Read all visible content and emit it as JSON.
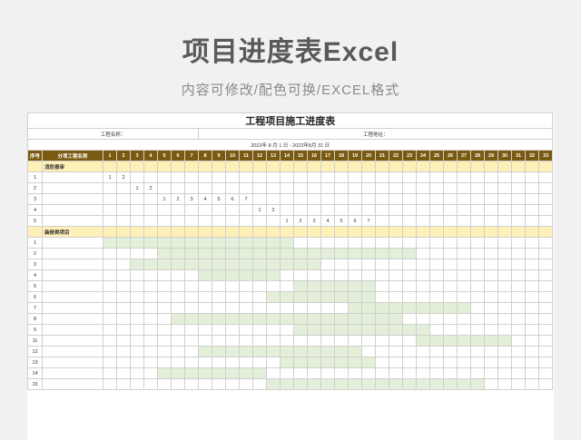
{
  "banner": {
    "title": "项目进度表Excel",
    "subtitle": "内容可修改/配色可换/EXCEL格式"
  },
  "sheet": {
    "title": "工程项目施工进度表",
    "project_name_label": "工程名称：",
    "project_address_label": "工程地址：",
    "date_range": "2022年 8 月 1 日 - 2022年8月 31 日",
    "col_index_header": "序号",
    "col_item_header": "分项工程名称",
    "days": [
      "1",
      "2",
      "3",
      "4",
      "5",
      "6",
      "7",
      "8",
      "9",
      "10",
      "11",
      "12",
      "13",
      "14",
      "15",
      "16",
      "17",
      "18",
      "19",
      "20",
      "21",
      "22",
      "23",
      "24",
      "25",
      "26",
      "27",
      "28",
      "29",
      "30",
      "31",
      "32",
      "33"
    ],
    "colors": {
      "header_bg": "#7a5a10",
      "category_bg": "#fff0b8",
      "bar_green": "#e3efd8"
    },
    "sections": [
      {
        "name": "消防报审",
        "rows": [
          {
            "no": "1",
            "cells": [
              {
                "day": 1,
                "text": "1"
              },
              {
                "day": 2,
                "text": "2"
              }
            ]
          },
          {
            "no": "2",
            "cells": [
              {
                "day": 3,
                "text": "1"
              },
              {
                "day": 4,
                "text": "2"
              }
            ]
          },
          {
            "no": "3",
            "cells": [
              {
                "day": 5,
                "text": "1"
              },
              {
                "day": 6,
                "text": "2"
              },
              {
                "day": 7,
                "text": "3"
              },
              {
                "day": 8,
                "text": "4"
              },
              {
                "day": 9,
                "text": "5"
              },
              {
                "day": 10,
                "text": "6"
              },
              {
                "day": 11,
                "text": "7"
              }
            ]
          },
          {
            "no": "4",
            "cells": [
              {
                "day": 12,
                "text": "1"
              },
              {
                "day": 13,
                "text": "2"
              }
            ]
          },
          {
            "no": "5",
            "cells": [
              {
                "day": 14,
                "text": "1"
              },
              {
                "day": 15,
                "text": "2"
              },
              {
                "day": 16,
                "text": "3"
              },
              {
                "day": 17,
                "text": "4"
              },
              {
                "day": 18,
                "text": "5"
              },
              {
                "day": 19,
                "text": "6"
              },
              {
                "day": 20,
                "text": "7"
              }
            ]
          }
        ]
      },
      {
        "name": "装修类项目",
        "rows": [
          {
            "no": "1",
            "bar": [
              1,
              14
            ]
          },
          {
            "no": "2",
            "bar": [
              5,
              23
            ]
          },
          {
            "no": "3",
            "bar": [
              3,
              16
            ]
          },
          {
            "no": "4",
            "bar": [
              8,
              13
            ]
          },
          {
            "no": "5",
            "bar": [
              15,
              20
            ]
          },
          {
            "no": "6",
            "bar": [
              13,
              20
            ]
          },
          {
            "no": "7",
            "bar": [
              19,
              27
            ]
          },
          {
            "no": "8",
            "bar": [
              6,
              22
            ]
          },
          {
            "no": "9",
            "bar": [
              15,
              24
            ]
          },
          {
            "no": "11",
            "bar": [
              24,
              30
            ]
          },
          {
            "no": "12",
            "bar": [
              8,
              19
            ]
          },
          {
            "no": "13",
            "bar": [
              14,
              20
            ]
          },
          {
            "no": "14",
            "bar": [
              5,
              12
            ]
          },
          {
            "no": "15",
            "bar": [
              13,
              28
            ]
          }
        ]
      }
    ]
  }
}
